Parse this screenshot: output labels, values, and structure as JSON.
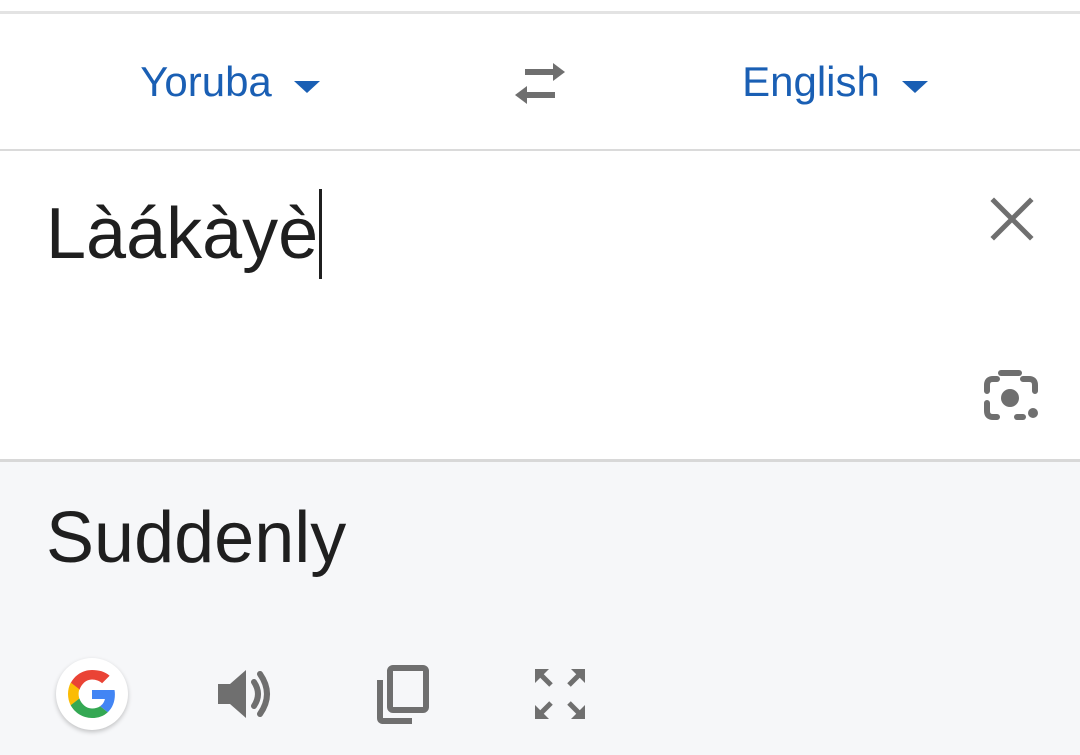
{
  "languages": {
    "source": "Yoruba",
    "target": "English"
  },
  "input": {
    "text": "Làákàyè"
  },
  "output": {
    "text": "Suddenly"
  },
  "icons": {
    "swap": "swap-arrows-icon",
    "source_caret": "caret-down-icon",
    "target_caret": "caret-down-icon",
    "clear": "close-icon",
    "camera": "camera-lens-icon",
    "google": "google-g-icon",
    "speak": "speaker-icon",
    "copy": "copy-icon",
    "expand": "fullscreen-icon"
  },
  "colors": {
    "accent": "#1a5fb4",
    "text": "#1f1f1f",
    "icon": "#6f6f6f",
    "output_bg": "#f6f7f9"
  }
}
